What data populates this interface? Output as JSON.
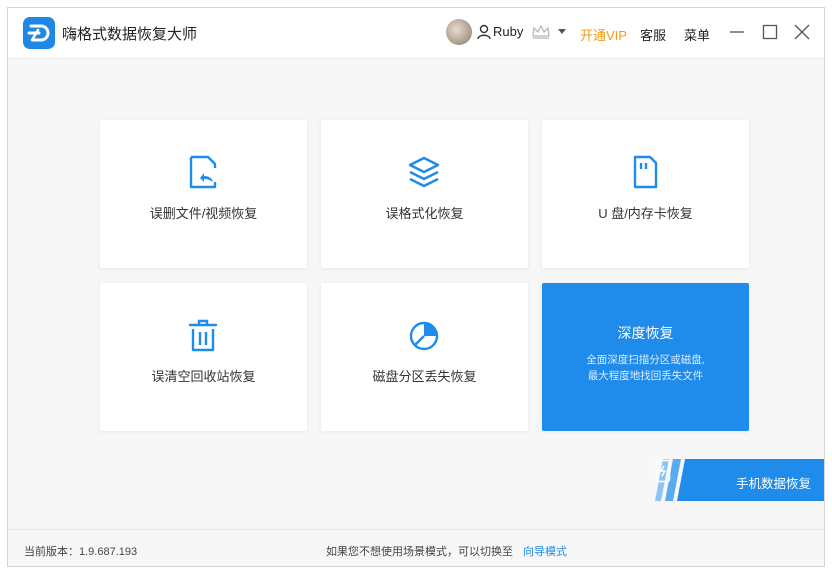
{
  "app": {
    "title": "嗨格式数据恢复大师"
  },
  "header": {
    "user_name": "Ruby",
    "vip_label": "开通VIP",
    "service_label": "客服",
    "menu_label": "菜单",
    "accent_color": "#1f8ceb",
    "vip_color": "#f39c12"
  },
  "cards": [
    {
      "label": "误删文件/视频恢复",
      "icon": "file-restore-icon"
    },
    {
      "label": "误格式化恢复",
      "icon": "layers-icon"
    },
    {
      "label": "U 盘/内存卡恢复",
      "icon": "sd-card-icon"
    },
    {
      "label": "误清空回收站恢复",
      "icon": "trash-icon"
    },
    {
      "label": "磁盘分区丢失恢复",
      "icon": "pie-partition-icon"
    }
  ],
  "deep_recovery": {
    "title": "深度恢复",
    "line1": "全面深度扫描分区或磁盘,",
    "line2": "最大程度地找回丢失文件"
  },
  "mobile": {
    "label": "手机数据恢复"
  },
  "status": {
    "version": "当前版本：1.9.687.193",
    "hint": "如果您不想使用场景模式，可以切换至",
    "guide_link": "向导模式"
  }
}
